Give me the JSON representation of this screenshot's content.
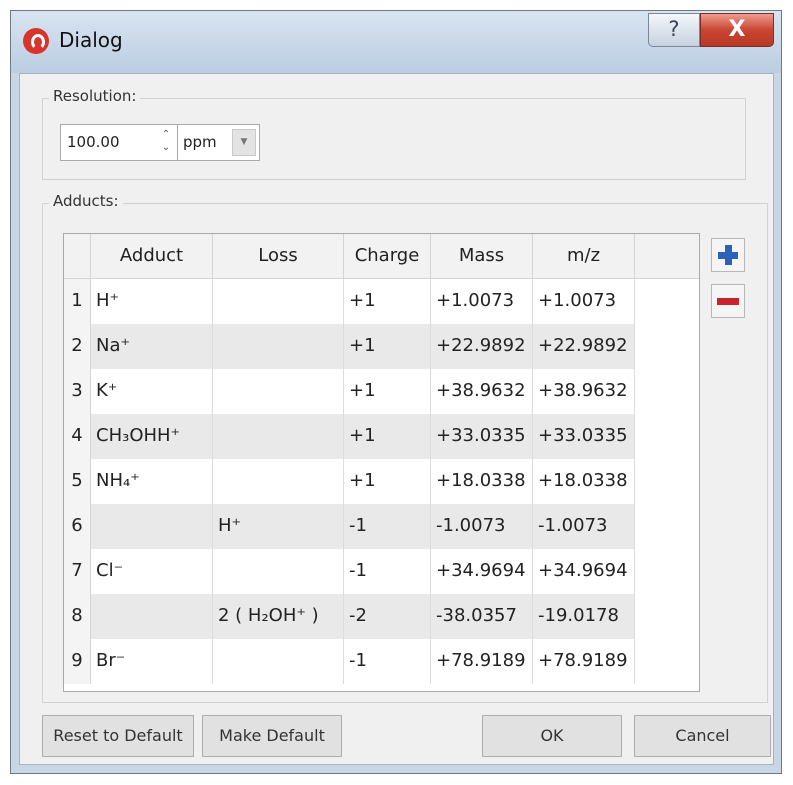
{
  "window": {
    "title": "Dialog",
    "help_glyph": "?",
    "close_glyph": "X"
  },
  "resolution": {
    "legend": "Resolution:",
    "value": "100.00",
    "unit": "ppm",
    "spin_up": "⌃",
    "spin_down": "⌄",
    "dropdown_arrow": "▼"
  },
  "adducts": {
    "legend": "Adducts:",
    "columns": [
      "Adduct",
      "Loss",
      "Charge",
      "Mass",
      "m/z"
    ],
    "rows": [
      {
        "num": "1",
        "adduct": "H⁺",
        "loss": "",
        "charge": "+1",
        "mass": "+1.0073",
        "mz": "+1.0073"
      },
      {
        "num": "2",
        "adduct": "Na⁺",
        "loss": "",
        "charge": "+1",
        "mass": "+22.9892",
        "mz": "+22.9892"
      },
      {
        "num": "3",
        "adduct": "K⁺",
        "loss": "",
        "charge": "+1",
        "mass": "+38.9632",
        "mz": "+38.9632"
      },
      {
        "num": "4",
        "adduct": "CH₃OHH⁺",
        "loss": "",
        "charge": "+1",
        "mass": "+33.0335",
        "mz": "+33.0335"
      },
      {
        "num": "5",
        "adduct": "NH₄⁺",
        "loss": "",
        "charge": "+1",
        "mass": "+18.0338",
        "mz": "+18.0338"
      },
      {
        "num": "6",
        "adduct": "",
        "loss": "H⁺",
        "charge": "-1",
        "mass": "-1.0073",
        "mz": "-1.0073"
      },
      {
        "num": "7",
        "adduct": "Cl⁻",
        "loss": "",
        "charge": "-1",
        "mass": "+34.9694",
        "mz": "+34.9694"
      },
      {
        "num": "8",
        "adduct": "",
        "loss": "2 ( H₂OH⁺ )",
        "charge": "-2",
        "mass": "-38.0357",
        "mz": "-19.0178"
      },
      {
        "num": "9",
        "adduct": "Br⁻",
        "loss": "",
        "charge": "-1",
        "mass": "+78.9189",
        "mz": "+78.9189"
      }
    ],
    "add_icon": "plus-icon",
    "remove_icon": "minus-icon"
  },
  "buttons": {
    "reset": "Reset to Default",
    "make_default": "Make Default",
    "ok": "OK",
    "cancel": "Cancel"
  },
  "colors": {
    "plus": "#2c63b8",
    "minus": "#c8242d",
    "close": "#c94533"
  }
}
